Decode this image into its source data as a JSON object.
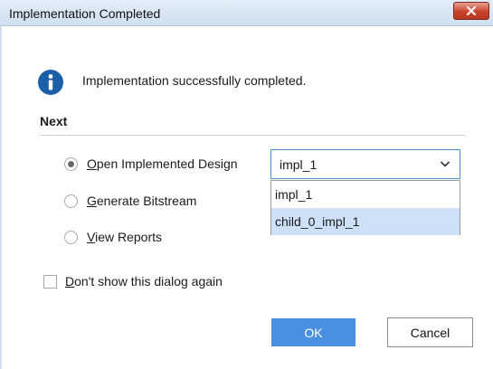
{
  "window": {
    "title": "Implementation Completed",
    "close_icon": "close-icon"
  },
  "message": {
    "icon": "info-icon",
    "text": "Implementation successfully completed."
  },
  "next": {
    "heading": "Next",
    "options": [
      {
        "label_mnemonic": "O",
        "label_rest": "pen Implemented Design",
        "selected": true
      },
      {
        "label_mnemonic": "G",
        "label_rest": "enerate Bitstream",
        "selected": false
      },
      {
        "label_mnemonic": "V",
        "label_rest": "iew Reports",
        "selected": false
      }
    ]
  },
  "run_select": {
    "value": "impl_1",
    "arrow_icon": "chevron-down-icon",
    "options": [
      "impl_1",
      "child_0_impl_1"
    ],
    "highlighted": "child_0_impl_1"
  },
  "dont_show": {
    "label_mnemonic": "D",
    "label_rest": "on't show this dialog again",
    "checked": false
  },
  "buttons": {
    "ok": "OK",
    "cancel": "Cancel"
  },
  "colors": {
    "accent": "#4a90e2",
    "info_icon": "#1c5fa8",
    "close_button": "#c8432a"
  }
}
